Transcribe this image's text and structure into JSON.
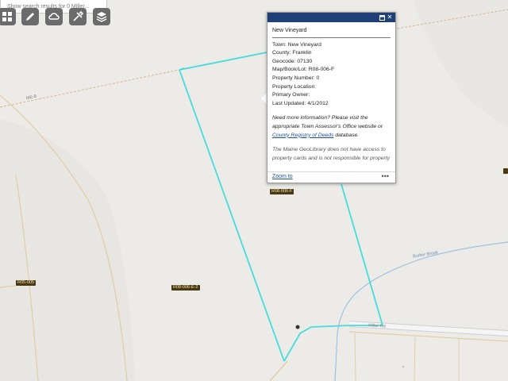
{
  "search": {
    "placeholder": "Show search results for 0 Miller..."
  },
  "toolbar": {
    "items": [
      {
        "name": "basemap-gallery-button",
        "icon": "grid-icon"
      },
      {
        "name": "draw-button",
        "icon": "pencil-icon"
      },
      {
        "name": "measure-button",
        "icon": "cloud-icon"
      },
      {
        "name": "edit-button",
        "icon": "tools-icon"
      },
      {
        "name": "layers-button",
        "icon": "layers-icon"
      }
    ]
  },
  "map": {
    "road_labels": [
      {
        "text": "ME-8"
      },
      {
        "text": "Miller Rd"
      }
    ],
    "stream_labels": [
      {
        "text": "Burker Brook"
      }
    ],
    "parcel_labels": [
      {
        "text": "R08-006-F"
      },
      {
        "text": "R05-005"
      },
      {
        "text": "R08-006-E-2"
      }
    ],
    "colors": {
      "parcel_outline": "#5fe3e3",
      "selected_parcel": "#46dcdc",
      "road": "#d7b98e",
      "stream": "#9fc3df",
      "background": "#ecebe8"
    }
  },
  "popup": {
    "title": "New Vineyard",
    "fields": [
      {
        "label": "Town:",
        "value": "New Vineyard"
      },
      {
        "label": "County:",
        "value": "Franklin"
      },
      {
        "label": "Geocode:",
        "value": "07130"
      },
      {
        "label": "Map/Book/Lot:",
        "value": "R08-006-F"
      },
      {
        "label": "Property Number:",
        "value": "0"
      },
      {
        "label": "Property Location:",
        "value": ""
      },
      {
        "label": "Primary Owner:",
        "value": ""
      },
      {
        "label": "Last Updated:",
        "value": "4/1/2012"
      }
    ],
    "note_part1": "Need more information? Please visit the appropriate Town Assessor's Office website or ",
    "note_link": "County Registry of Deeds",
    "note_part2": " database.",
    "note2": "The Maine GeoLibrary does not have access to property cards and is not responsible for property updates.",
    "zoom_label": "Zoom to",
    "more_label": "•••"
  }
}
